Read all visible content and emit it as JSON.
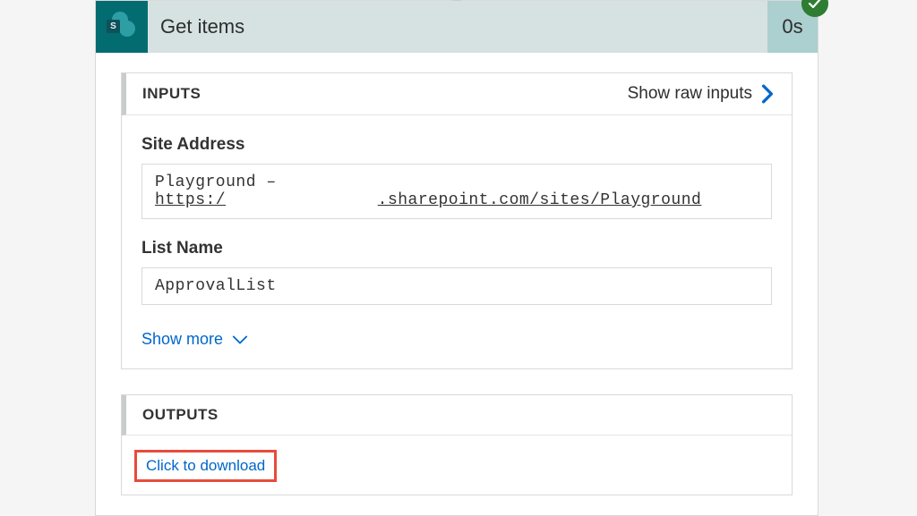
{
  "action": {
    "title": "Get items",
    "duration": "0s",
    "status": "success"
  },
  "inputs": {
    "header": "INPUTS",
    "raw_label": "Show raw inputs",
    "site_address": {
      "label": "Site Address",
      "prefix": "Playground – ",
      "url_scheme": "https:/",
      "url_rest": ".sharepoint.com/sites/Playground"
    },
    "list_name": {
      "label": "List Name",
      "value": "ApprovalList"
    },
    "show_more": "Show more"
  },
  "outputs": {
    "header": "OUTPUTS",
    "download": "Click to download"
  }
}
